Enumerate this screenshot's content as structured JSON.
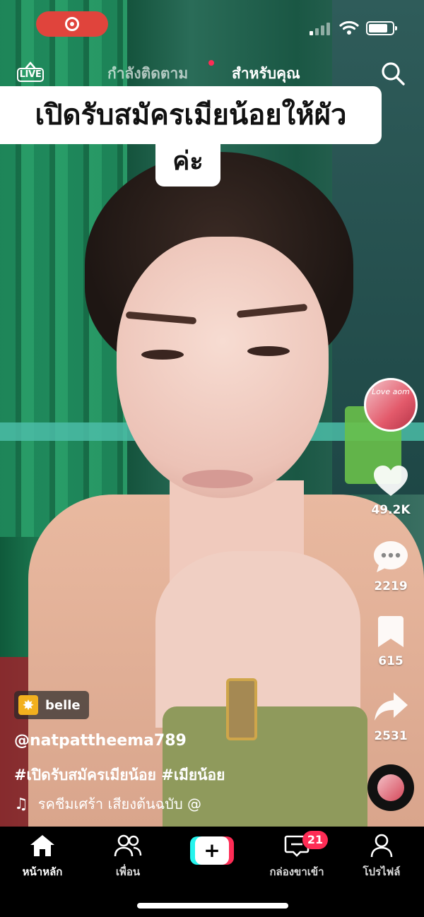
{
  "status_bar": {
    "recording_color": "#e0443c"
  },
  "top_nav": {
    "live_label": "LIVE",
    "tab_following": "กำลังติดตาม",
    "tab_foryou": "สำหรับคุณ",
    "search_icon": "search-icon"
  },
  "caption": {
    "line1": "เปิดรับสมัครเมียน้อยให้ผัว",
    "line2": "ค่ะ"
  },
  "creator_avatar": {
    "overlay_text": "Love aom"
  },
  "actions": {
    "likes": "49.2K",
    "comments": "2219",
    "saves": "615",
    "shares": "2531"
  },
  "video_info": {
    "sticker_label": "belle",
    "username": "@natpattheema789",
    "hashtags": "#เปิดรับสมัครเมียน้อย #เมียน้อย",
    "sound": "รคชีมเศร้า เสียงต้นฉบับ  @"
  },
  "bottom_nav": {
    "home": "หน้าหลัก",
    "friends": "เพื่อน",
    "create": "+",
    "inbox": "กล่องขาเข้า",
    "inbox_badge": "21",
    "profile": "โปรไฟล์"
  },
  "colors": {
    "accent_red": "#fe2c55",
    "accent_cyan": "#25f4ee"
  }
}
